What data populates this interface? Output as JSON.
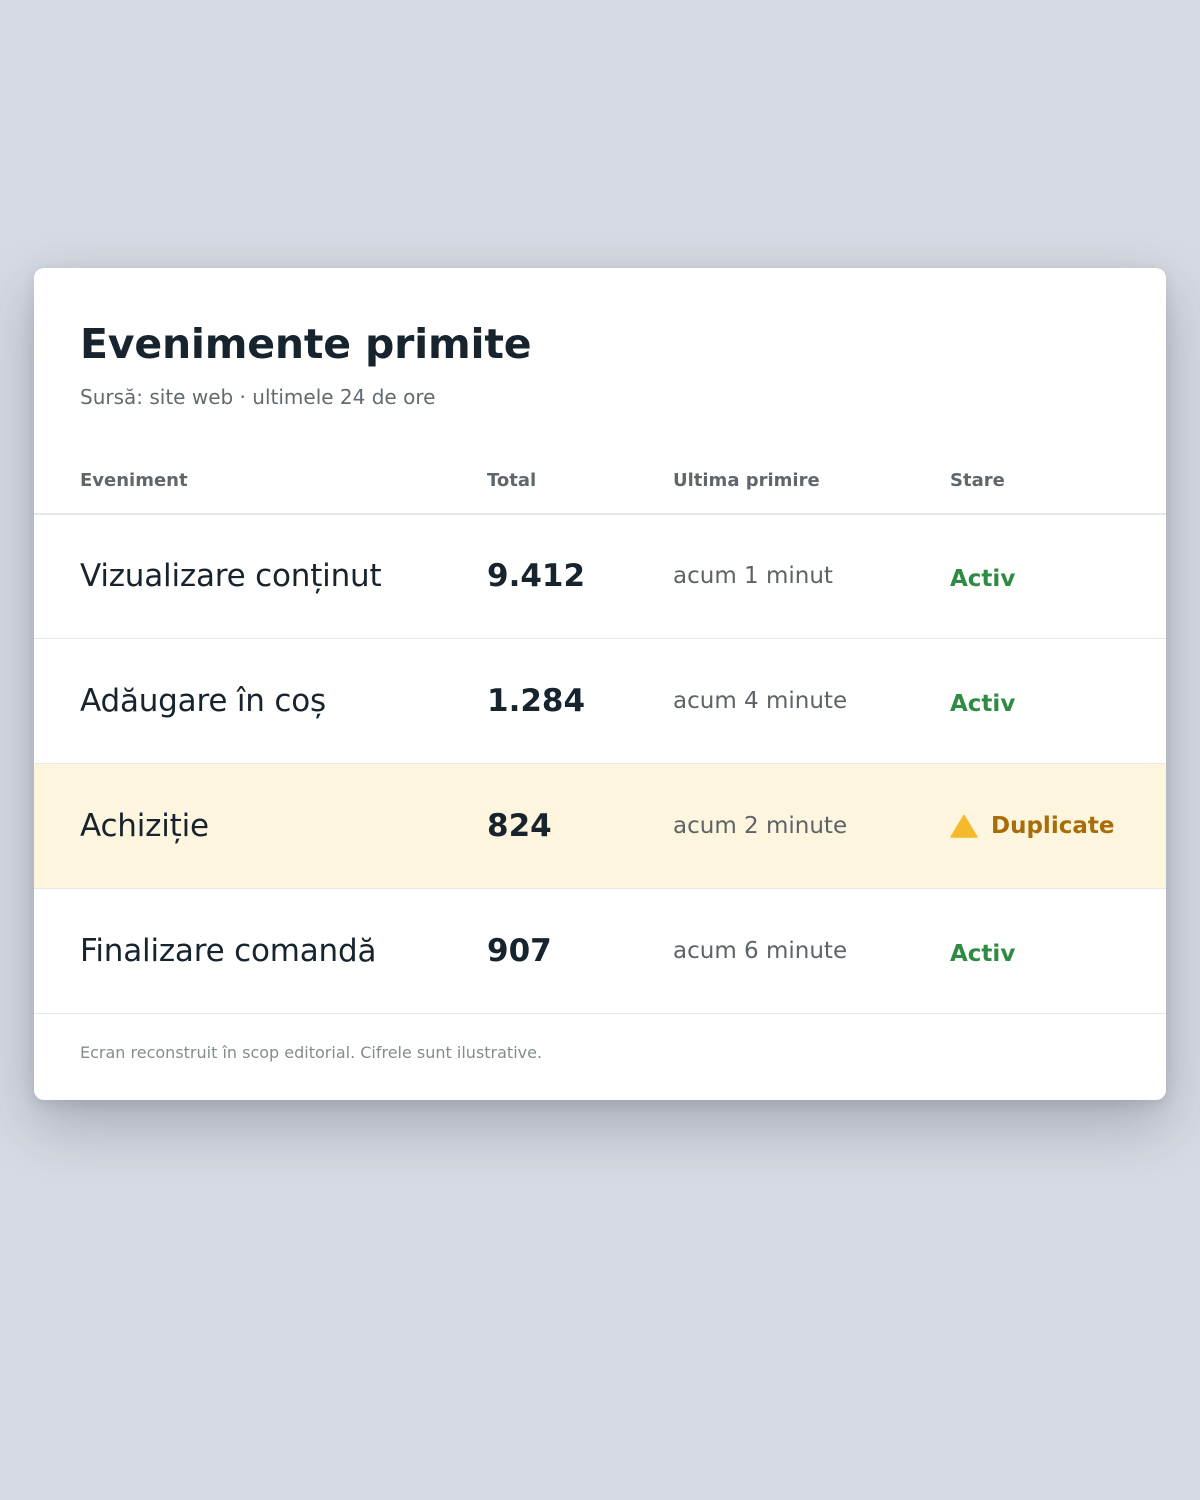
{
  "card": {
    "title": "Evenimente primite",
    "subtitle": "Sursă: site web · ultimele 24 de ore"
  },
  "table": {
    "headers": {
      "event": "Eveniment",
      "total": "Total",
      "last": "Ultima primire",
      "status": "Stare"
    },
    "rows": [
      {
        "name": "Vizualizare conținut",
        "total": "9.412",
        "last": "acum 1 minut",
        "status": "Activ"
      },
      {
        "name": "Adăugare în coș",
        "total": "1.284",
        "last": "acum 4 minute",
        "status": "Activ"
      },
      {
        "name": "Achiziție",
        "total": "824",
        "last": "acum 2 minute",
        "status": "Duplicate",
        "status_icon": "warning-triangle-icon"
      },
      {
        "name": "Finalizare comandă",
        "total": "907",
        "last": "acum 6 minute",
        "status": "Activ"
      }
    ]
  },
  "footer": {
    "note": "Ecran reconstruit în scop editorial. Cifrele sunt ilustrative."
  },
  "colors": {
    "page_background": "#d6dae2",
    "card_background": "#ffffff",
    "text_primary": "#17242d",
    "status_active": "#2f8b44",
    "status_duplicate": "#a86c08",
    "warning_row_background": "#fdf5de",
    "warning_icon": "#f5b92b"
  }
}
